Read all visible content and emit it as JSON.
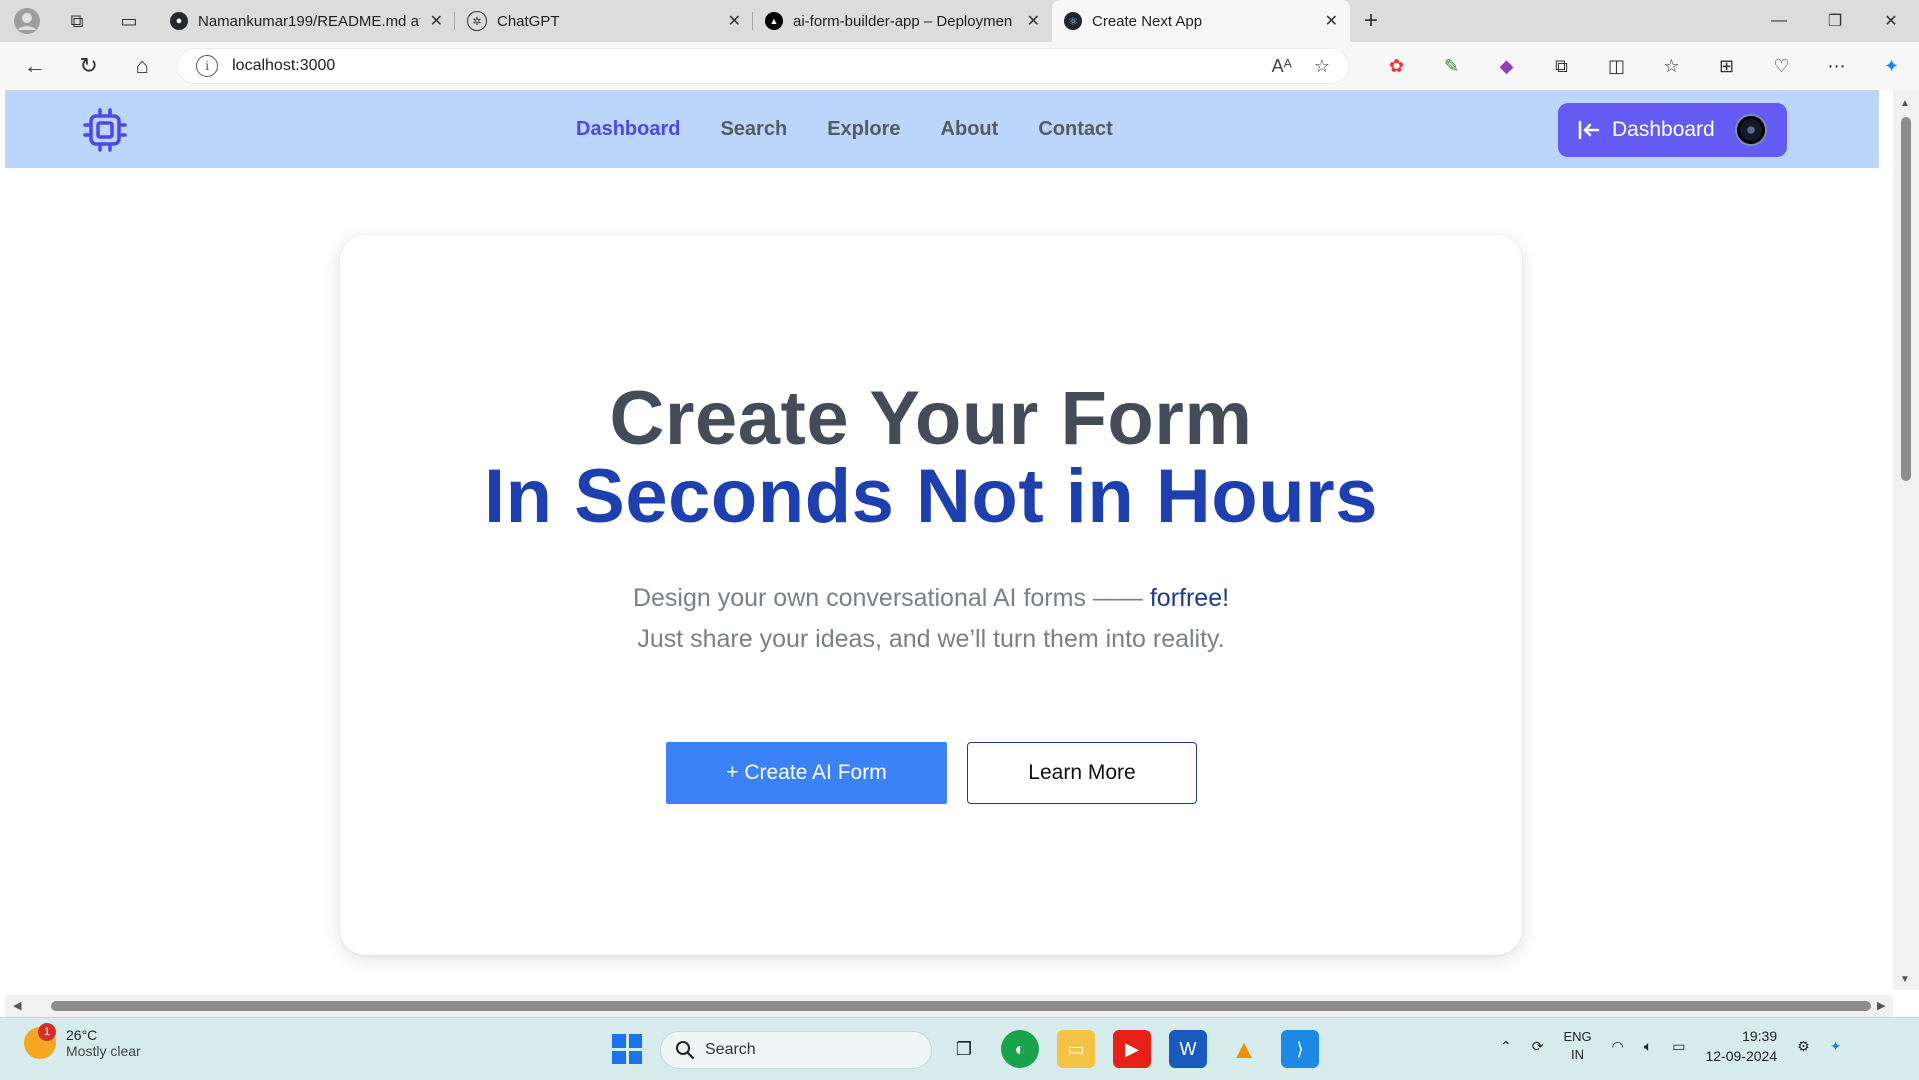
{
  "browser": {
    "tabs": [
      {
        "title": "Namankumar199/README.md at",
        "icon": "github-icon"
      },
      {
        "title": "ChatGPT",
        "icon": "openai-icon"
      },
      {
        "title": "ai-form-builder-app – Deploymen",
        "icon": "vercel-icon"
      },
      {
        "title": "Create Next App",
        "icon": "react-icon",
        "active": true
      }
    ],
    "url": "localhost:3000"
  },
  "site": {
    "nav": {
      "links": [
        "Dashboard",
        "Search",
        "Explore",
        "About",
        "Contact"
      ],
      "active": "Dashboard"
    },
    "dashboard_button": "Dashboard",
    "hero": {
      "title_line1": "Create Your Form",
      "title_line2": "In Seconds Not in Hours",
      "desc_part1": "Design your own conversational AI forms ——",
      "desc_highlight": "forfree!",
      "desc_part2": " Just share your ideas, and we’ll turn them into reality.",
      "primary_button": "+ Create AI Form",
      "secondary_button": "Learn More"
    },
    "colors": {
      "nav_bg": "#bcd6fb",
      "accent": "#635bf2",
      "headline_blue": "#1e3fae",
      "primary_button": "#3b82f6"
    }
  },
  "taskbar": {
    "weather_temp": "26°C",
    "weather_desc": "Mostly clear",
    "weather_badge": "1",
    "search_label": "Search",
    "lang_line1": "ENG",
    "lang_line2": "IN",
    "time": "19:39",
    "date": "12-09-2024"
  }
}
